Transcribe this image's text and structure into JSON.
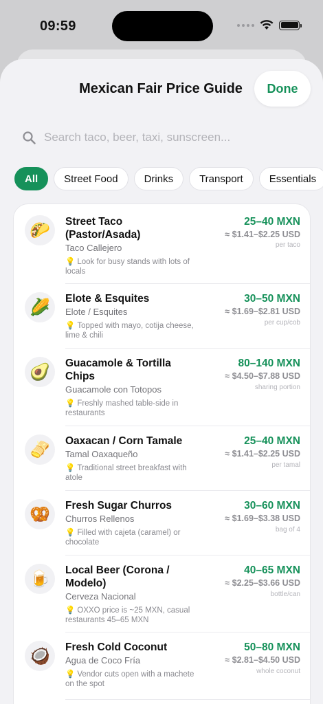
{
  "status_bar": {
    "time": "09:59"
  },
  "header": {
    "title": "Mexican Fair Price Guide",
    "done_label": "Done"
  },
  "search": {
    "placeholder": "Search taco, beer, taxi, sunscreen..."
  },
  "categories": [
    "All",
    "Street Food",
    "Drinks",
    "Transport",
    "Essentials"
  ],
  "selected_category": "All",
  "colors": {
    "accent": "#16915a",
    "background": "#f2f2f5",
    "tip_bulb": "#f3c640"
  },
  "items": [
    {
      "icon": "taco-icon",
      "emoji": "🌮",
      "name": "Street Taco (Pastor/Asada)",
      "local": "Taco Callejero",
      "tip": "Look for busy stands with lots of locals",
      "mxn": "25–40 MXN",
      "usd": "≈ $1.41–$2.25 USD",
      "unit": "per taco"
    },
    {
      "icon": "corn-icon",
      "emoji": "🌽",
      "name": "Elote & Esquites",
      "local": "Elote / Esquites",
      "tip": "Topped with mayo, cotija cheese, lime & chili",
      "mxn": "30–50 MXN",
      "usd": "≈ $1.69–$2.81 USD",
      "unit": "per cup/cob"
    },
    {
      "icon": "avocado-icon",
      "emoji": "🥑",
      "name": "Guacamole & Tortilla Chips",
      "local": "Guacamole con Totopos",
      "tip": "Freshly mashed table-side in restaurants",
      "mxn": "80–140 MXN",
      "usd": "≈ $4.50–$7.88 USD",
      "unit": "sharing portion"
    },
    {
      "icon": "tamale-icon",
      "emoji": "🫔",
      "name": "Oaxacan / Corn Tamale",
      "local": "Tamal Oaxaqueño",
      "tip": "Traditional street breakfast with atole",
      "mxn": "25–40 MXN",
      "usd": "≈ $1.41–$2.25 USD",
      "unit": "per tamal"
    },
    {
      "icon": "pretzel-icon",
      "emoji": "🥨",
      "name": "Fresh Sugar Churros",
      "local": "Churros Rellenos",
      "tip": "Filled with cajeta (caramel) or chocolate",
      "mxn": "30–60 MXN",
      "usd": "≈ $1.69–$3.38 USD",
      "unit": "bag of 4"
    },
    {
      "icon": "beer-mug-icon",
      "emoji": "🍺",
      "name": "Local Beer (Corona / Modelo)",
      "local": "Cerveza Nacional",
      "tip": "OXXO price is ~25 MXN, casual restaurants 45–65 MXN",
      "mxn": "40–65 MXN",
      "usd": "≈ $2.25–$3.66 USD",
      "unit": "bottle/can"
    },
    {
      "icon": "coconut-icon",
      "emoji": "🥥",
      "name": "Fresh Cold Coconut",
      "local": "Agua de Coco Fría",
      "tip": "Vendor cuts open with a machete on the spot",
      "mxn": "50–80 MXN",
      "usd": "≈ $2.81–$4.50 USD",
      "unit": "whole coconut"
    }
  ]
}
